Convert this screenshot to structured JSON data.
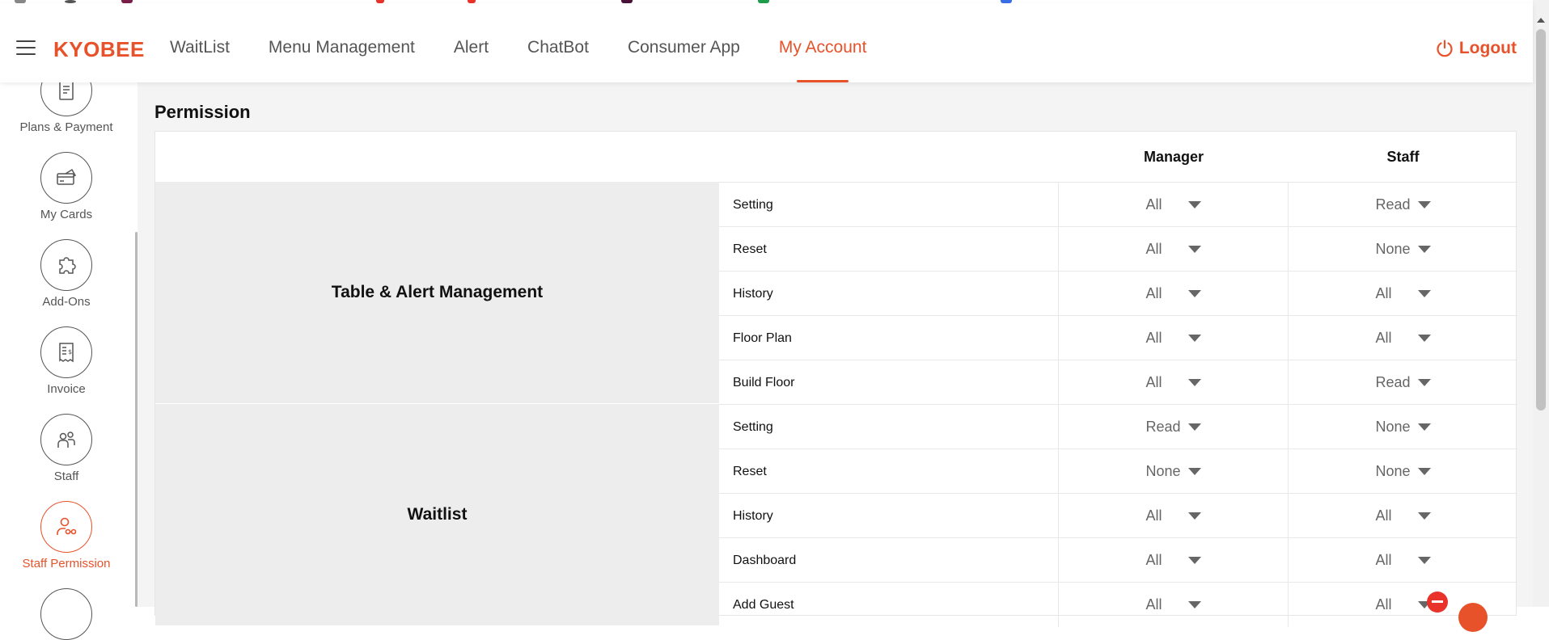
{
  "brand": {
    "logo": "KYOBEE",
    "accent": "#e8522a"
  },
  "nav": {
    "items": [
      {
        "label": "WaitList"
      },
      {
        "label": "Menu Management"
      },
      {
        "label": "Alert"
      },
      {
        "label": "ChatBot"
      },
      {
        "label": "Consumer App"
      },
      {
        "label": "My Account"
      }
    ],
    "active": "My Account",
    "logout_label": "Logout"
  },
  "sidebar": {
    "items": [
      {
        "label": "Plans & Payment",
        "icon": "plans-icon"
      },
      {
        "label": "My Cards",
        "icon": "card-icon"
      },
      {
        "label": "Add-Ons",
        "icon": "puzzle-icon"
      },
      {
        "label": "Invoice",
        "icon": "invoice-icon"
      },
      {
        "label": "Staff",
        "icon": "staff-icon"
      },
      {
        "label": "Staff Permission",
        "icon": "staff-permission-icon"
      }
    ],
    "active": "Staff Permission"
  },
  "page": {
    "title": "Permission",
    "columns": {
      "manager": "Manager",
      "staff": "Staff"
    },
    "groups": [
      {
        "name": "Table & Alert Management",
        "rows": [
          {
            "name": "Setting",
            "manager": "All",
            "staff": "Read"
          },
          {
            "name": "Reset",
            "manager": "All",
            "staff": "None"
          },
          {
            "name": "History",
            "manager": "All",
            "staff": "All"
          },
          {
            "name": "Floor Plan",
            "manager": "All",
            "staff": "All"
          },
          {
            "name": "Build Floor",
            "manager": "All",
            "staff": "Read"
          }
        ]
      },
      {
        "name": "Waitlist",
        "rows": [
          {
            "name": "Setting",
            "manager": "Read",
            "staff": "None"
          },
          {
            "name": "Reset",
            "manager": "None",
            "staff": "None"
          },
          {
            "name": "History",
            "manager": "All",
            "staff": "All"
          },
          {
            "name": "Dashboard",
            "manager": "All",
            "staff": "All"
          },
          {
            "name": "Add Guest",
            "manager": "All",
            "staff": "All"
          }
        ]
      }
    ]
  }
}
